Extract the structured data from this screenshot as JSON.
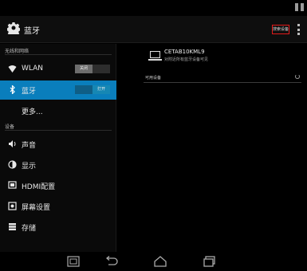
{
  "status_bar": {
    "icons": [
      "signal-icon",
      "battery-icon"
    ]
  },
  "action_bar": {
    "title": "蓝牙",
    "search_button": "搜索设备",
    "app_icon": "gear-icon",
    "overflow_icon": "overflow-menu-icon"
  },
  "sidebar": {
    "sections": [
      {
        "heading": "无线和网络"
      },
      {
        "heading": "设备"
      }
    ],
    "items": [
      {
        "label": "WLAN",
        "icon": "wifi-icon",
        "toggle": "关闭",
        "selected": false
      },
      {
        "label": "蓝牙",
        "icon": "bluetooth-icon",
        "toggle": "打开",
        "selected": true
      },
      {
        "label": "更多...",
        "icon": "",
        "selected": false
      },
      {
        "label": "声音",
        "icon": "speaker-icon",
        "selected": false
      },
      {
        "label": "显示",
        "icon": "display-icon",
        "selected": false
      },
      {
        "label": "HDMI配置",
        "icon": "hdmi-icon",
        "selected": false
      },
      {
        "label": "屏幕设置",
        "icon": "screen-settings-icon",
        "selected": false
      },
      {
        "label": "存储",
        "icon": "storage-icon",
        "selected": false
      }
    ]
  },
  "bluetooth_panel": {
    "device_name": "CETAB10KML9",
    "device_status": "对附近所有蓝牙设备可见",
    "available_devices_label": "可用设备"
  },
  "nav_bar": {
    "buttons": [
      "screenshot-icon",
      "back-icon",
      "home-icon",
      "recent-apps-icon"
    ]
  }
}
